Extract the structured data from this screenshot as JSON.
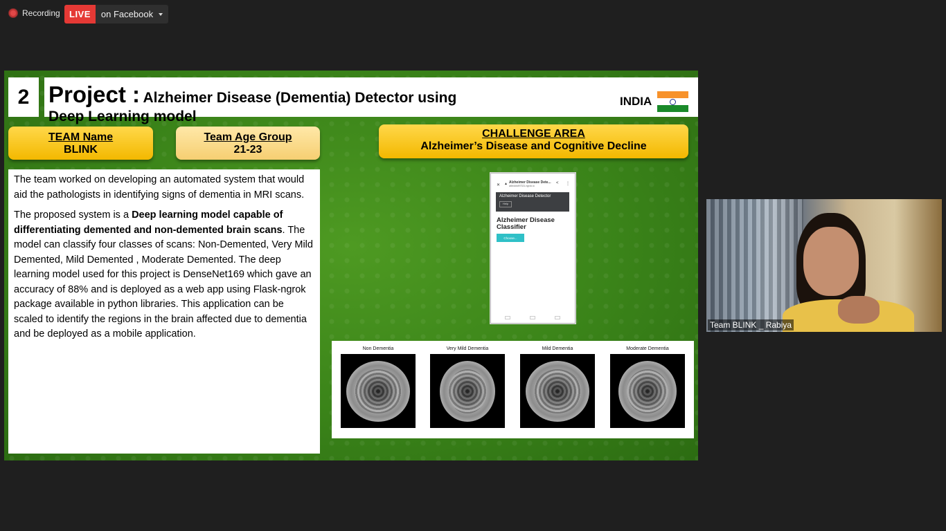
{
  "top_bar": {
    "recording_label": "Recording",
    "live_label": "LIVE",
    "destination_label": "on Facebook"
  },
  "slide": {
    "number": "2",
    "title_prefix": "Project :",
    "title_line1": "Alzheimer Disease (Dementia) Detector using",
    "title_line2": "Deep Learning model",
    "country": "INDIA",
    "team_name_label": "TEAM Name",
    "team_name_value": "BLINK",
    "age_group_label": "Team Age Group",
    "age_group_value": "21-23",
    "challenge_label": "CHALLENGE AREA",
    "challenge_value": "Alzheimer’s Disease and Cognitive Decline",
    "para1": "The team worked on developing an automated system that would aid the pathologists in identifying signs of dementia in MRI scans.",
    "para2_pre": "The proposed system is a ",
    "para2_bold": "Deep learning model capable of differentiating demented and non-demented brain scans",
    "para2_post": ". The model can classify four classes of scans: Non-Demented, Very Mild Demented, Mild Demented , Moderate Demented. The deep learning model used for this project is DenseNet169 which gave an accuracy of 88% and is deployed as a web app using Flask-ngrok package available in python libraries. This application can be scaled to identify the regions in the brain affected due to dementia and be deployed as a mobile application.",
    "phone": {
      "tab_title": "Alzheimer Disease Dete...",
      "tab_url": "a6b4d4d97321.ngrok.io",
      "header_title": "Alzheimer Disease Detector",
      "header_btn": "Help",
      "page_title_line1": "Alzheimer Disease",
      "page_title_line2": "Classifier",
      "choose_button": "Choose..."
    },
    "mri_labels": [
      "Non Dementia",
      "Very Mild Dementia",
      "Mild Dementia",
      "Moderate Dementia"
    ]
  },
  "webcam": {
    "participant_label": "Team BLINK _ Rabiya"
  },
  "colors": {
    "slide_green": "#3a8319",
    "pill_yellow": "#f3b800",
    "live_red": "#e53935",
    "saffron": "#f7922b",
    "india_green": "#1a8a2a"
  }
}
